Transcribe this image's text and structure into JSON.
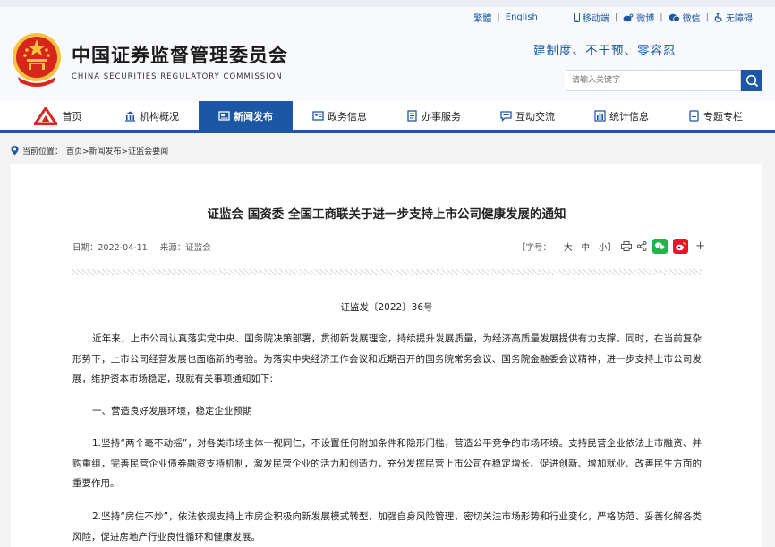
{
  "toplinks": {
    "traditional": "繁體",
    "english": "English",
    "mobile": "移动端",
    "weibo": "微博",
    "wechat": "微信",
    "accessibility": "无障碍"
  },
  "site": {
    "title": "中国证券监督管理委员会",
    "subtitle": "CHINA SECURITIES REGULATORY COMMISSION",
    "slogan": "建制度、不干预、零容忍"
  },
  "search": {
    "placeholder": "请输入关键字"
  },
  "nav": {
    "items": [
      {
        "label": "首页"
      },
      {
        "label": "机构概况"
      },
      {
        "label": "新闻发布"
      },
      {
        "label": "政务信息"
      },
      {
        "label": "办事服务"
      },
      {
        "label": "互动交流"
      },
      {
        "label": "统计信息"
      },
      {
        "label": "专题专栏"
      }
    ],
    "active": "新闻发布"
  },
  "breadcrumb": {
    "prefix": "当前位置：",
    "path": "首页>新闻发布>证监会要闻"
  },
  "article": {
    "title": "证监会  国资委  全国工商联关于进一步支持上市公司健康发展的通知",
    "date": "日期：2022-04-11",
    "source": "来源：证监会",
    "font_label": "【字号：",
    "font_large": "大",
    "font_medium": "中",
    "font_small": "小】",
    "doc_number": "证监发〔2022〕36号",
    "paragraphs": [
      "近年来，上市公司认真落实党中央、国务院决策部署，贯彻新发展理念，持续提升发展质量，为经济高质量发展提供有力支撑。同时，在当前复杂形势下，上市公司经营发展也面临新的考验。为落实中央经济工作会议和近期召开的国务院常务会议、国务院金融委会议精神，进一步支持上市公司发展，维护资本市场稳定，现就有关事项通知如下:",
      "一、营造良好发展环境，稳定企业预期",
      "1.坚持“两个毫不动摇”，对各类市场主体一视同仁，不设置任何附加条件和隐形门槛，营造公平竞争的市场环境。支持民营企业依法上市融资、并购重组，完善民营企业债券融资支持机制，激发民营企业的活力和创造力，充分发挥民营上市公司在稳定增长、促进创新、增加就业、改善民生方面的重要作用。",
      "2.坚持“房住不炒”，依法依规支持上市房企积极向新发展模式转型，加强自身风险管理，密切关注市场形势和行业变化，严格防范、妥善化解各类风险，促进房地产行业良性循环和健康发展。"
    ]
  },
  "colors": {
    "brand_blue": "#1c57a5",
    "emblem_red": "#d7261c",
    "emblem_gold": "#f5c23a",
    "wechat_green": "#21b34a",
    "weibo_red": "#e6162d"
  }
}
